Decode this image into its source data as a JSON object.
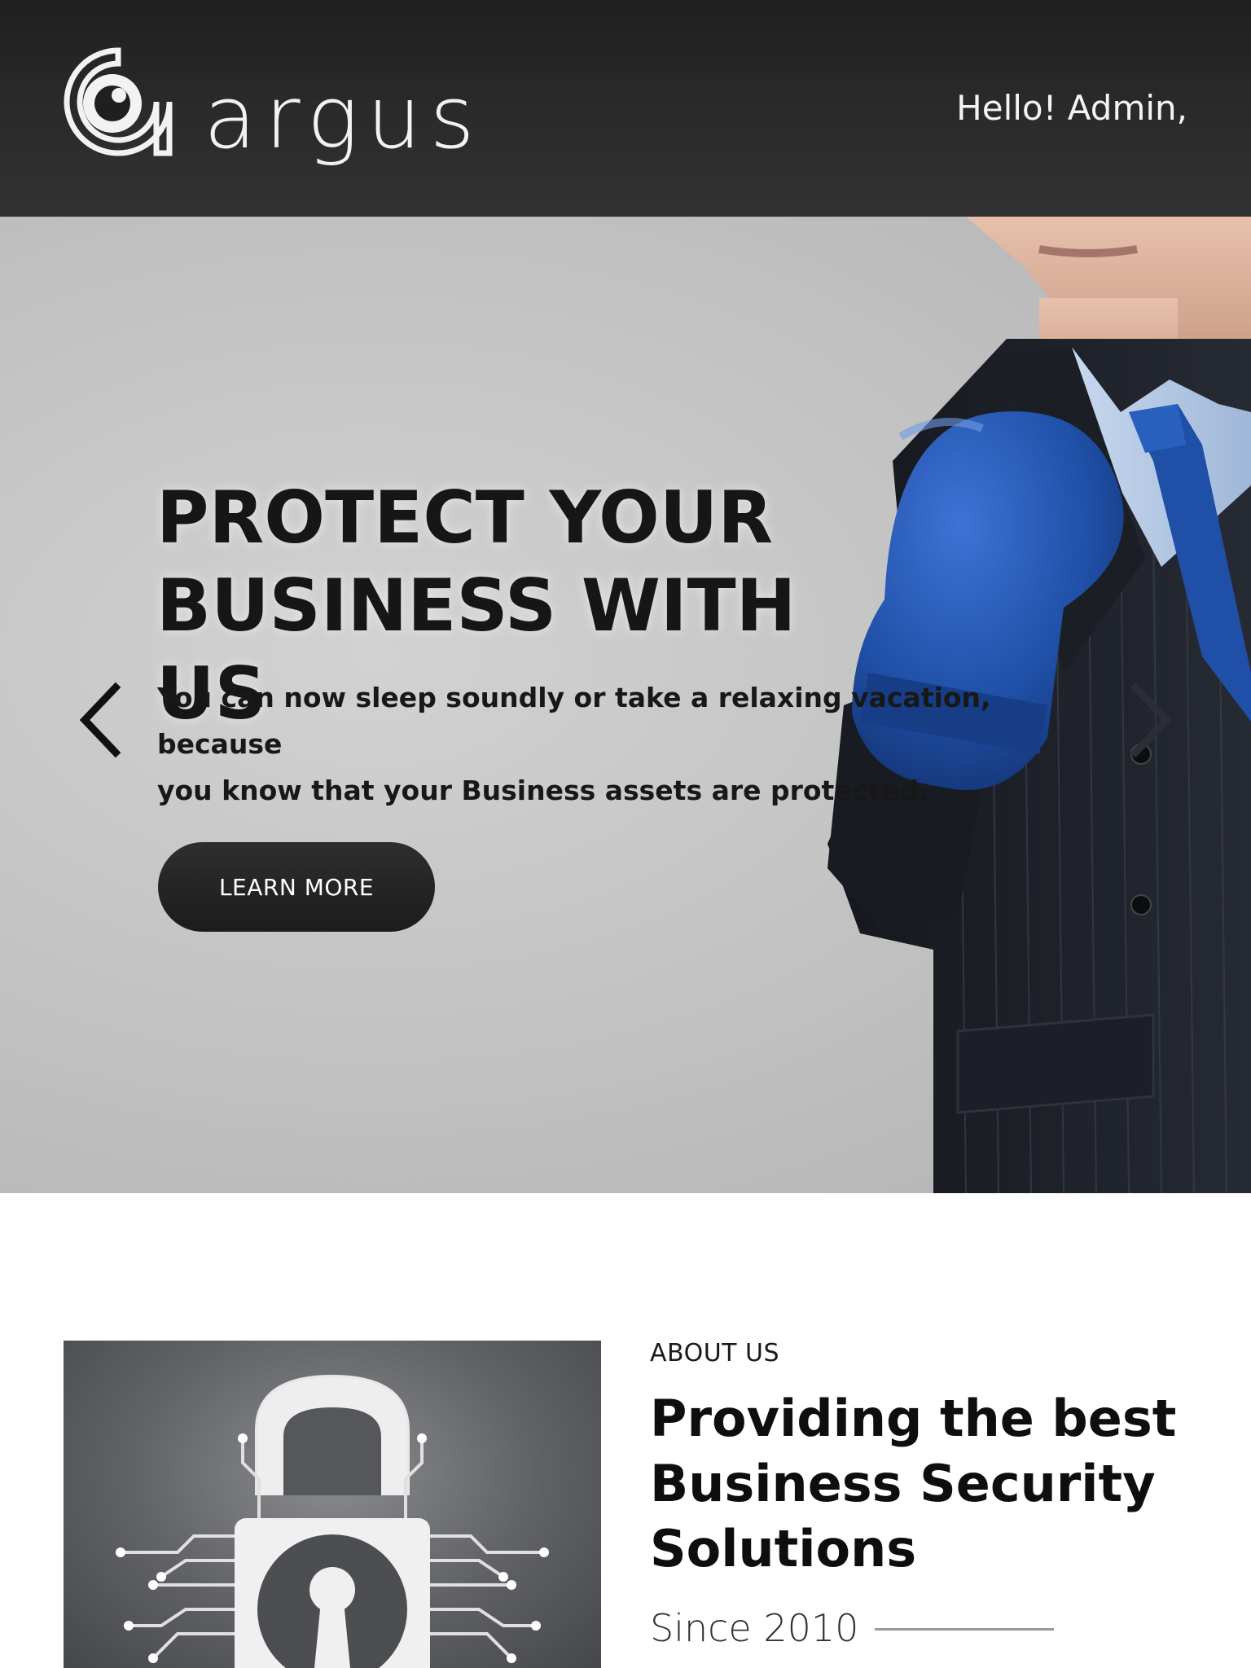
{
  "header": {
    "logo_text": "argus",
    "greeting": "Hello! Admin,"
  },
  "hero": {
    "title_line1": "PROTECT YOUR",
    "title_line2": "BUSINESS WITH US",
    "text_line1": "You can now sleep soundly or take a relaxing vacation, because",
    "text_line2": "you know that your Business assets are protected.",
    "button_label": "LEARN MORE"
  },
  "about": {
    "label": "ABOUT US",
    "heading_line1": "Providing the best",
    "heading_line2": "Business Security",
    "heading_line3": "Solutions",
    "since": "Since 2010"
  },
  "colors": {
    "header_bg": "#2a2a2a",
    "hero_bg": "#c4c4c4",
    "button_bg": "#222222",
    "glove_blue": "#1e4fa8"
  },
  "icons": {
    "logo_mark": "eye-at-icon",
    "prev": "chevron-left-icon",
    "next": "chevron-right-icon",
    "about_image": "padlock-circuit-icon"
  }
}
